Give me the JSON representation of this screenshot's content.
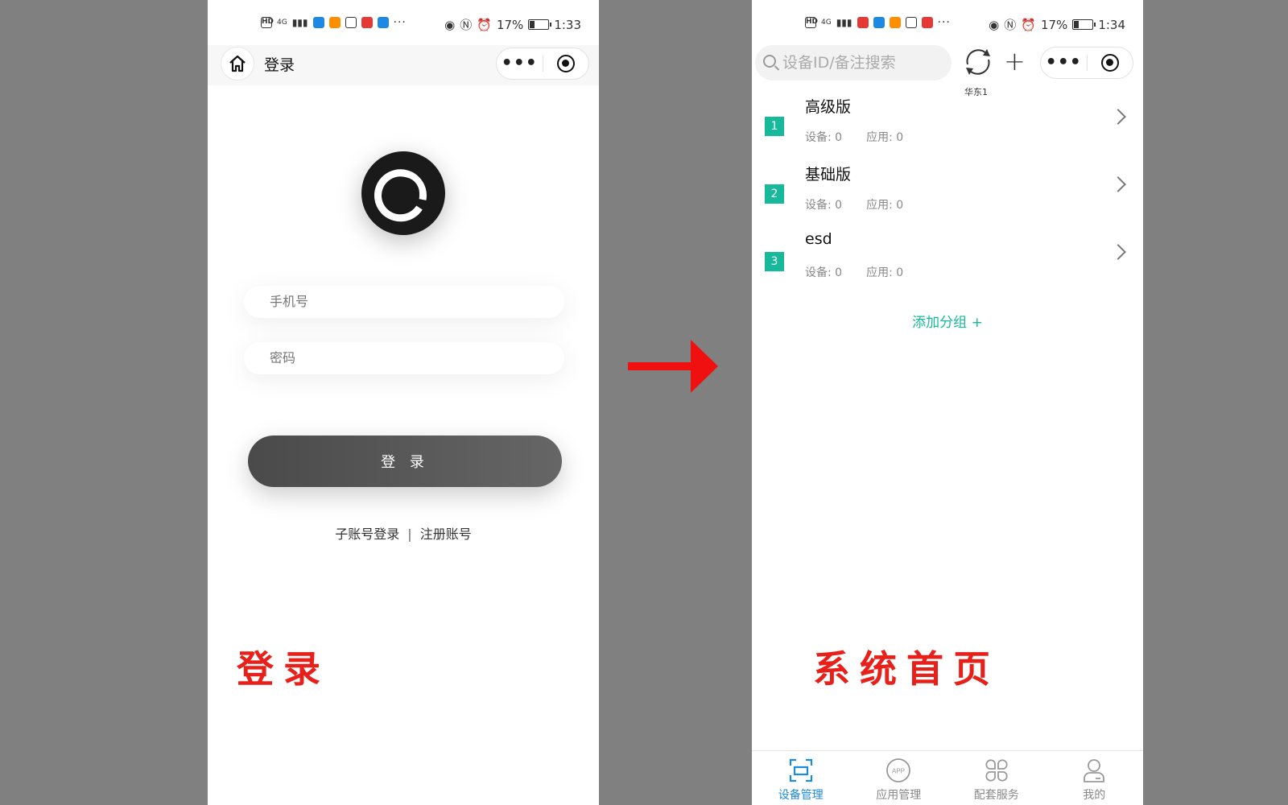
{
  "left_phone": {
    "status": {
      "time": "1:33",
      "battery": "17%",
      "net": "4G"
    },
    "nav_title": "登录",
    "phone_placeholder": "手机号",
    "password_placeholder": "密码",
    "login_button": "登 录",
    "sub_account_link": "子账号登录",
    "separator": "|",
    "register_link": "注册账号",
    "caption": "登录"
  },
  "right_phone": {
    "status": {
      "time": "1:34",
      "battery": "17%",
      "net": "4G"
    },
    "search_placeholder": "设备ID/备注搜索",
    "region": "华东1",
    "groups": [
      {
        "index": "1",
        "name": "高级版",
        "devices": "设备: 0",
        "apps": "应用: 0"
      },
      {
        "index": "2",
        "name": "基础版",
        "devices": "设备: 0",
        "apps": "应用: 0"
      },
      {
        "index": "3",
        "name": "esd",
        "devices": "设备: 0",
        "apps": "应用: 0"
      }
    ],
    "add_group": "添加分组 +",
    "tabs": [
      {
        "label": "设备管理",
        "icon": "device-scan-icon",
        "active": true
      },
      {
        "label": "应用管理",
        "icon": "app-icon",
        "active": false
      },
      {
        "label": "配套服务",
        "icon": "clover-grid-icon",
        "active": false
      },
      {
        "label": "我的",
        "icon": "user-icon",
        "active": false
      }
    ],
    "app_icon_text": "APP",
    "caption": "系统首页"
  },
  "colors": {
    "accent": "#16b99a",
    "tab_active": "#1a8be0",
    "caption": "#e8201a",
    "arrow": "#f01010"
  }
}
